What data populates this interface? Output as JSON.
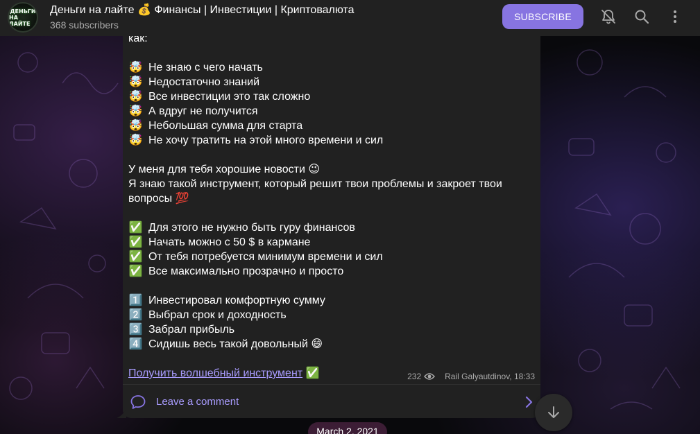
{
  "header": {
    "avatar_lines": [
      "ДЕНЬГИ",
      "НА ЛАЙТЕ"
    ],
    "title": "Деньги на лайте 💰  Финансы | Инвестиции | Криптовалюта",
    "subscribers": "368 subscribers",
    "subscribe_label": "SUBSCRIBE",
    "icons": [
      "bell-muted-icon",
      "search-icon",
      "more-vertical-icon"
    ]
  },
  "message": {
    "lines": [
      {
        "kind": "text",
        "text": "как:"
      },
      {
        "kind": "blank"
      },
      {
        "kind": "item",
        "emoji": "🤯",
        "text": "Не знаю с чего начать"
      },
      {
        "kind": "item",
        "emoji": "🤯",
        "text": "Недостаточно знаний"
      },
      {
        "kind": "item",
        "emoji": "🤯",
        "text": "Все инвестиции это так сложно"
      },
      {
        "kind": "item",
        "emoji": "🤯",
        "text": "А вдруг не получится"
      },
      {
        "kind": "item",
        "emoji": "🤯",
        "text": "Небольшая сумма для старта"
      },
      {
        "kind": "item",
        "emoji": "🤯",
        "text": "Не хочу тратить на этой много времени и сил"
      },
      {
        "kind": "blank"
      },
      {
        "kind": "text",
        "text": "У меня для тебя хорошие новости 😉"
      },
      {
        "kind": "text",
        "text": "Я знаю такой инструмент, который  решит твои проблемы и закроет твои"
      },
      {
        "kind": "text",
        "text": "вопросы 💯"
      },
      {
        "kind": "blank"
      },
      {
        "kind": "item",
        "emoji": "✅",
        "text": "Для этого не нужно быть гуру финансов"
      },
      {
        "kind": "item",
        "emoji": "✅",
        "text": "Начать можно с 50 $ в кармане"
      },
      {
        "kind": "item",
        "emoji": "✅",
        "text": "От тебя потребуется минимум времени и сил"
      },
      {
        "kind": "item",
        "emoji": "✅",
        "text": "Все максимально прозрачно и просто"
      },
      {
        "kind": "blank"
      },
      {
        "kind": "item",
        "emoji": "1️⃣",
        "text": "Инвестировал комфортную сумму"
      },
      {
        "kind": "item",
        "emoji": "2️⃣",
        "text": "Выбрал срок и доходность"
      },
      {
        "kind": "item",
        "emoji": "3️⃣",
        "text": "Забрал прибыль"
      },
      {
        "kind": "item",
        "emoji": "4️⃣",
        "text": "Сидишь весь такой довольный 😄"
      },
      {
        "kind": "blank"
      }
    ],
    "link_text": "Получить волшебный инструмент",
    "link_suffix": " ✅",
    "views": "232",
    "author_time": "Rail Galyautdinov, 18:33",
    "comment_label": "Leave a comment"
  },
  "date_pill": "March 2, 2021",
  "colors": {
    "accent": "#8774e1",
    "link": "#a99cff",
    "bubble": "#212121",
    "header": "#212121"
  }
}
